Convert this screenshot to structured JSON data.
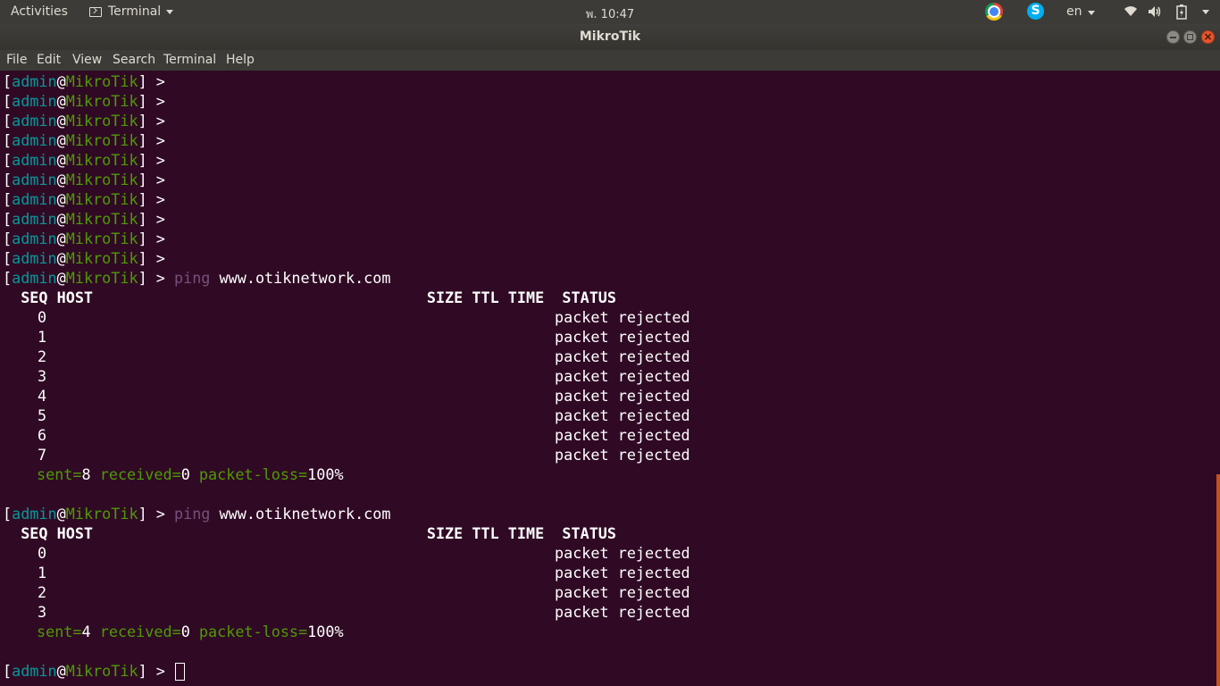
{
  "topbar": {
    "activities": "Activities",
    "app_menu": "Terminal",
    "clock": "พ. 10:47",
    "language": "en",
    "icons": [
      "chrome-icon",
      "skype-icon",
      "wifi-icon",
      "volume-icon",
      "battery-icon"
    ],
    "skype_glyph": "S"
  },
  "window": {
    "title": "MikroTik",
    "close_glyph": "×"
  },
  "menubar": {
    "items": [
      "File",
      "Edit",
      "View",
      "Search",
      "Terminal",
      "Help"
    ]
  },
  "prompt": {
    "open": "[",
    "user": "admin",
    "at": "@",
    "host": "MikroTik",
    "close": "] >"
  },
  "terminal": {
    "empty_prompt_count": 10,
    "ping_cmd": "ping",
    "ping_target": "www.otiknetwork.com",
    "header": "  SEQ HOST                                     SIZE TTL TIME  STATUS",
    "status_text": "packet rejected",
    "ping1": {
      "seqs": [
        "0",
        "1",
        "2",
        "3",
        "4",
        "5",
        "6",
        "7"
      ],
      "sent": "8",
      "received": "0",
      "loss": "100%"
    },
    "ping2": {
      "seqs": [
        "0",
        "1",
        "2",
        "3"
      ],
      "sent": "4",
      "received": "0",
      "loss": "100%"
    },
    "summary_keys": {
      "sent": "sent=",
      "received": " received=",
      "loss": " packet-loss="
    }
  },
  "colors": {
    "background": "#300a24",
    "user": "#06989a",
    "host": "#4e9a06",
    "command": "#75507b",
    "scrollbar": "#c5511d"
  }
}
